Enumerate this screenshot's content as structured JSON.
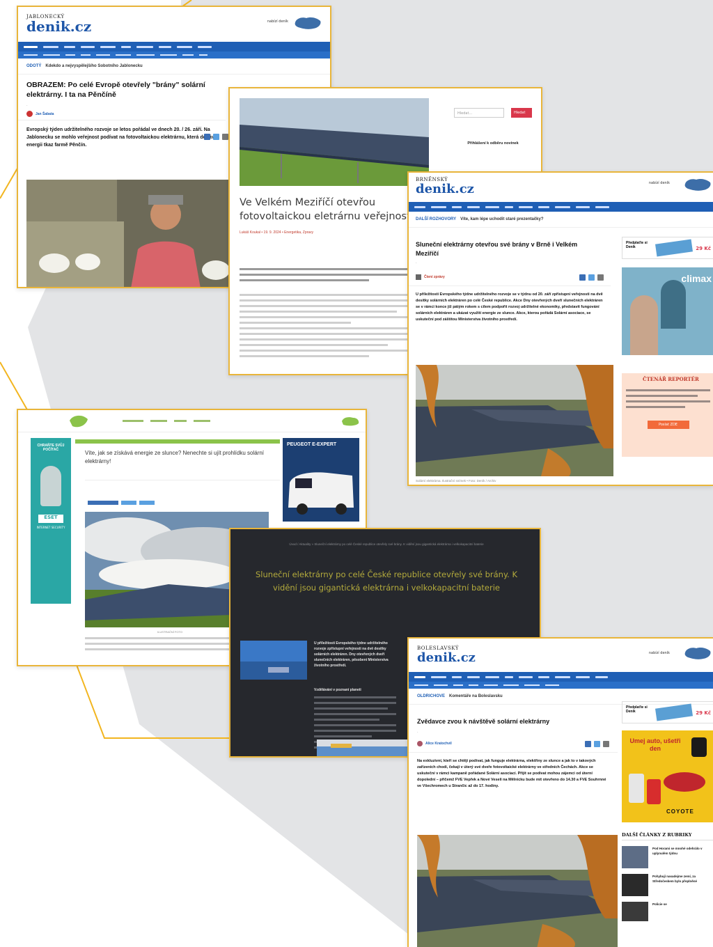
{
  "card1": {
    "logo_kicker": "JABLONECKÝ",
    "logo_main": "denik.cz",
    "header_right": "nabízí deník",
    "breadcrumb_tag": "ODOTÝ",
    "breadcrumb_text": "Kdekdo a nejvyspělejšího Sobotního Jablonecku",
    "title": "OBRAZEM: Po celé Evropě otevřely \"brány\" solární elektrárny. I ta na Pěnčíně",
    "author": "Jan Šabata",
    "lead": "Evropský týden udržitelného rozvoje se letos pořádal ve dnech 20. / 26. září. Na Jablonecku se mohlo veřejnost podívat na fotovoltaickou elektrárnu, která dodává energii tkaz farmě Pěnčín."
  },
  "card2": {
    "title": "Ve Velkém Meziříčí otevřou fotovoltaickou eletrárnu veřejnosti",
    "meta": "Lukáš Koukal • 19. 9. 2024 • Energetika, Zpravy",
    "search_placeholder": "Hledat...",
    "search_button": "Hledat",
    "login_title": "Přihlášení k odběru novinek"
  },
  "card3": {
    "logo_kicker": "BRNĚNSKÝ",
    "logo_main": "denik.cz",
    "header_right": "nabízí deník",
    "breadcrumb_tag": "DALŠÍ ROZHOVORY",
    "breadcrumb_text": "Víte, kam lépe uchodit staré prezentačky?",
    "title": "Sluneční elektrárny otevřou své brány v Brně i Velkém Meziříčí",
    "author": "Čtení zprávy",
    "lead": "U příležitosti Evropského týdne udržitelného rozvoje se v týdnu od 20. září zpřístupní veřejnosti na dvě desítky solárních elektráren po celé České republice. Akce Dny otevřených dveří slunečních elektráren se v rámci konce již pátým rokem s cílem podpořit rozvoj udržitelné ekonomiky, představit fungování solárních elektráren a ukázat využití energie ze slunce. Akce, kterou pořádá Solární asociace, se uskuteční pod záštitou Ministerstva životního prostředí.",
    "caption": "Solární elektrárna. Ilustrační snímek • Foto: Deník / Archiv",
    "ad1_label": "Předplaťte si Deník",
    "ad1_price": "29 Kč",
    "ad2_brand": "climax",
    "reporter_title": "ČTENÁŘ REPORTÉR",
    "reporter_button": "Poslat ZDE"
  },
  "card4": {
    "title": "Víte, jak se získává energie ze slunce? Nenechte si ujít prohlídku solární elektrárny!",
    "ad_left_title": "CHRAŇTE SVŮJ POČÍTAČ",
    "ad_left_brand": "ESET",
    "ad_left_product": "INTERNET SECURITY",
    "ad_right_title": "PEUGEOT E-EXPERT",
    "caption": "ILUSTRAČNÍ FOTO"
  },
  "card5": {
    "breadcrumb": "Úvod / Aktuality » Sluneční elektrárny po celé České republice otevřely své brány. K vidění jsou gigantická elektrárna i velkokapacitní baterie",
    "title": "Sluneční elektrárny po celé České republice otevřely své brány. K vidění jsou gigantická elektrárna i velkokapacitní baterie",
    "subhead": "Vzdělávání v poznaní planeti",
    "lead": "U příležitosti Evropského týdne udržitelného rozvoje zpřístupní veřejnosti na dvě desítky solárních elektráren. Dny otevřených dveří slunečních elektráren, pěsobení Ministerstva životního prostředí."
  },
  "card6": {
    "logo_kicker": "BOLESLAVSKÝ",
    "logo_main": "denik.cz",
    "header_right": "nabízí deník",
    "breadcrumb_tag": "OLDRICHOVE",
    "breadcrumb_text": "Komentáře na Boleslavsku",
    "title": "Zvědavce zvou k návštěvě solární elektrárny",
    "author": "Alice Kratochvil",
    "lead": "Na exkluzivní, kteří se chtějí podívat, jak funguje elektrárna, elektřiny ze slunce a jak to v takových zařízeních chodí, čekají v úterý své dveře fotovoltaické elektrárny ve středních Čechách. Akce se uskuteční v rámci kampaně pořádané Solární asociací. Přijít se podívat mohou zájemci od úterní dopolední – přičemž FVE Vepřek a Nové Veselí na Mělnicku bude mít otevřeno do 14.30 a FVE Souhrnné ve Všechromech u Strančic až do 17. hodiny.",
    "ad1_label": "Předplaťte si Deník",
    "ad1_price": "29 Kč",
    "ad2_title": "Umej auto, ušetři den",
    "ad2_brand": "COYOTE",
    "rubric_title": "DALŠÍ ČLÁNKY Z RUBRIKY",
    "rubric_items": [
      "Pod Horami se mnohé odehrálo v uplynulém týdnu",
      "Pohybují nasadejme zemí, za Středočeskem bylo přeplněné",
      "Policie se"
    ]
  },
  "colors": {
    "frame": "#e9b53a",
    "denik_blue": "#1f5fb5",
    "green": "#8bc34a",
    "dark": "#26282d",
    "background_shape": "#e3e4e6",
    "accent_line": "#f2b51f"
  }
}
